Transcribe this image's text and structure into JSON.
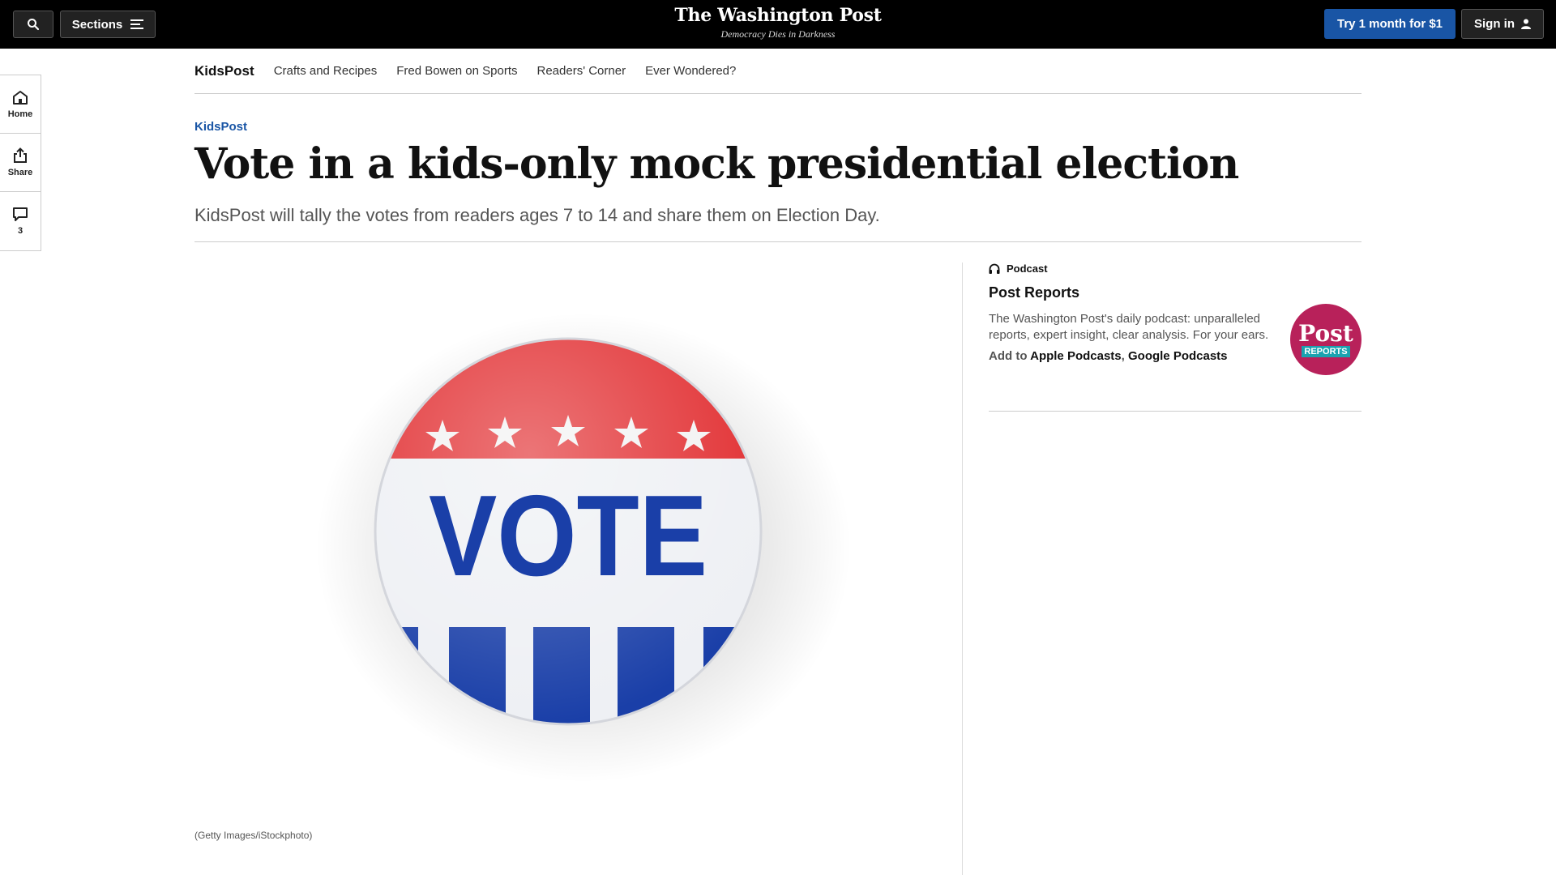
{
  "header": {
    "sections_label": "Sections",
    "logo": "The Washington Post",
    "tagline": "Democracy Dies in Darkness",
    "try_label": "Try 1 month for $1",
    "signin_label": "Sign in"
  },
  "rail": {
    "home_label": "Home",
    "share_label": "Share",
    "comments_count": "3"
  },
  "subnav": {
    "brand": "KidsPost",
    "links": [
      "Crafts and Recipes",
      "Fred Bowen on Sports",
      "Readers' Corner",
      "Ever Wondered?"
    ]
  },
  "article": {
    "kicker": "KidsPost",
    "headline": "Vote in a kids-only mock presidential election",
    "dek": "KidsPost will tally the votes from readers ages 7 to 14 and share them on Election Day.",
    "image_text": "VOTE",
    "caption": "(Getty Images/iStockphoto)"
  },
  "podcast": {
    "label": "Podcast",
    "title": "Post Reports",
    "description": "The Washington Post's daily podcast: unparalleled reports, expert insight, clear analysis. For your ears.",
    "add_to": "Add to",
    "apple": "Apple Podcasts",
    "google": "Google Podcasts",
    "logo_line1": "Post",
    "logo_line2": "REPORTS"
  },
  "colors": {
    "accent": "#1955a5",
    "button_red": "#e12b2e",
    "button_blue": "#1a3fa8",
    "podcast_logo": "#b8215a"
  },
  "icons": [
    "search-icon",
    "menu-icon",
    "user-icon",
    "home-icon",
    "share-icon",
    "comment-icon",
    "headphones-icon"
  ]
}
